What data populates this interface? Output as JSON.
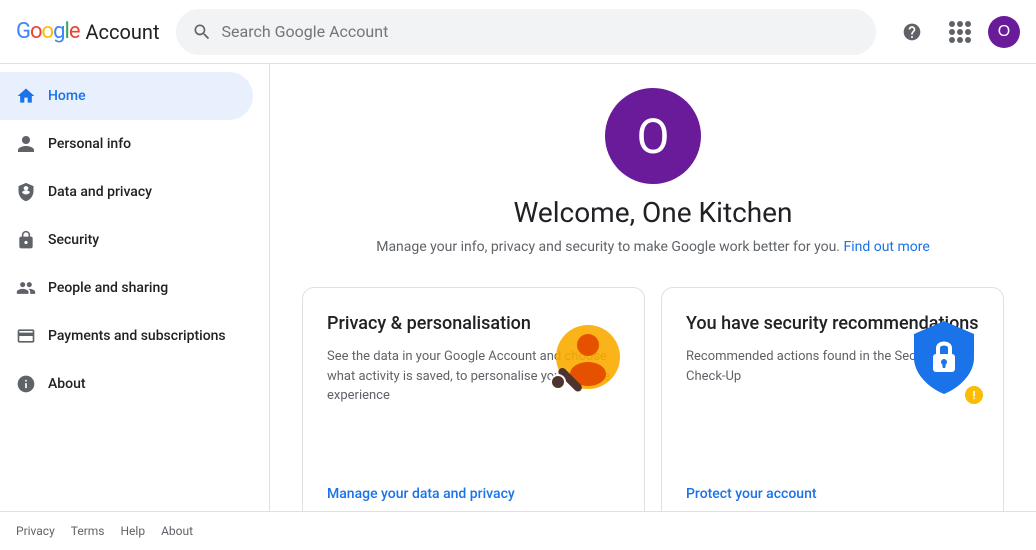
{
  "header": {
    "logo_text": "Google",
    "title": "Account",
    "search_placeholder": "Search Google Account"
  },
  "sidebar": {
    "items": [
      {
        "id": "home",
        "label": "Home",
        "icon": "home-icon",
        "active": true
      },
      {
        "id": "personal-info",
        "label": "Personal info",
        "icon": "person-icon",
        "active": false
      },
      {
        "id": "data-privacy",
        "label": "Data and privacy",
        "icon": "shield-check-icon",
        "active": false
      },
      {
        "id": "security",
        "label": "Security",
        "icon": "lock-icon",
        "active": false
      },
      {
        "id": "people-sharing",
        "label": "People and sharing",
        "icon": "people-icon",
        "active": false
      },
      {
        "id": "payments",
        "label": "Payments and subscriptions",
        "icon": "credit-card-icon",
        "active": false
      },
      {
        "id": "about",
        "label": "About",
        "icon": "info-icon",
        "active": false
      }
    ]
  },
  "main": {
    "profile_initial": "O",
    "welcome_text": "Welcome, One Kitchen",
    "subtitle": "Manage your info, privacy and security to make Google work better for you.",
    "find_out_more": "Find out more",
    "cards": [
      {
        "id": "privacy-card",
        "title": "Privacy & personalisation",
        "description": "See the data in your Google Account and choose what activity is saved, to personalise your Google experience",
        "link_text": "Manage your data and privacy"
      },
      {
        "id": "security-card",
        "title": "You have security recommendations",
        "description": "Recommended actions found in the Security Check-Up",
        "link_text": "Protect your account"
      }
    ]
  },
  "footer": {
    "links": [
      "Privacy",
      "Terms",
      "Help",
      "About"
    ]
  },
  "avatar": {
    "initial": "O",
    "bg_color": "#6A1B9A"
  }
}
